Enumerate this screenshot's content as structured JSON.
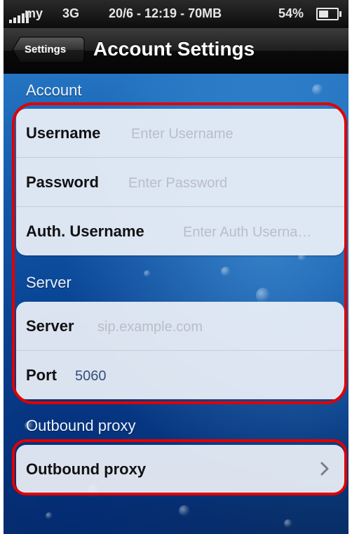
{
  "status_bar": {
    "carrier": "my",
    "network": "3G",
    "datetime": "20/6 - 12:19 - 70MB",
    "battery": "54%"
  },
  "nav": {
    "back_label": "Settings",
    "title": "Account Settings"
  },
  "sections": {
    "account": {
      "header": "Account",
      "username": {
        "label": "Username",
        "placeholder": "Enter Username"
      },
      "password": {
        "label": "Password",
        "placeholder": "Enter Password"
      },
      "auth_username": {
        "label": "Auth. Username",
        "placeholder": "Enter Auth Userna…"
      }
    },
    "server": {
      "header": "Server",
      "server": {
        "label": "Server",
        "placeholder": "sip.example.com"
      },
      "port": {
        "label": "Port",
        "value": "5060"
      }
    },
    "outbound": {
      "header": "Outbound proxy",
      "proxy": {
        "label": "Outbound proxy"
      }
    }
  },
  "colors": {
    "annotation": "#e10000",
    "background": "#1a67b8"
  },
  "icons": {
    "chevron": "chevron-right-icon",
    "signal": "signal-bars-icon",
    "battery": "battery-icon"
  }
}
